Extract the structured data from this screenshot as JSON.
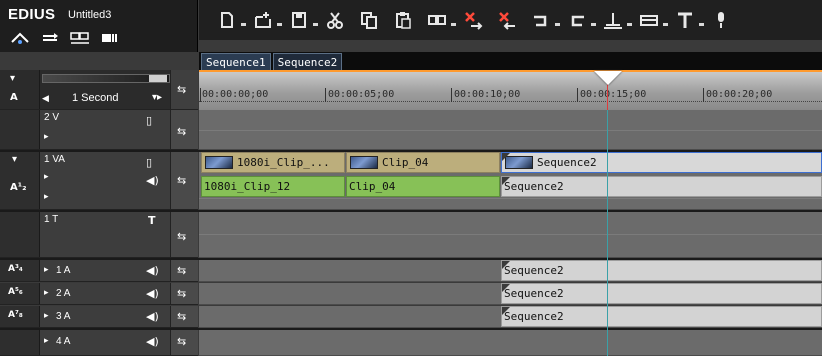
{
  "app": {
    "name": "EDIUS",
    "project": "Untitled3"
  },
  "tabs": [
    {
      "label": "Sequence1"
    },
    {
      "label": "Sequence2"
    }
  ],
  "ruler": {
    "timecodes": [
      "00:00:00;00",
      "00:00:05;00",
      "00:00:10;00",
      "00:00:15;00",
      "00:00:20;00"
    ],
    "scale_label": "1 Second"
  },
  "tracks": {
    "v2": {
      "name": "2 V"
    },
    "va1": {
      "name": "1 VA"
    },
    "t1": {
      "name": "1 T",
      "icon": "T"
    },
    "a1": {
      "name": "1 A"
    },
    "a2": {
      "name": "2 A"
    },
    "a3": {
      "name": "3 A"
    },
    "a4": {
      "name": "4 A"
    }
  },
  "clips": {
    "video": [
      {
        "label": "1080i_Clip_..."
      },
      {
        "label": "Clip_04"
      },
      {
        "label": "Sequence2"
      }
    ],
    "audio": [
      {
        "label": "1080i_Clip_12"
      },
      {
        "label": "Clip_04"
      },
      {
        "label": "Sequence2"
      }
    ],
    "audio_tracks_sequence_label": "Sequence2"
  },
  "colors": {
    "accent_orange": "#ff9a2e",
    "video_clip": "#bcae7c",
    "audio_clip": "#87c157",
    "selected_border": "#3d6fd1",
    "playhead": "#3aa1a8"
  },
  "icons": {
    "toolbar": [
      "new-sequence-icon",
      "add-track-icon",
      "save-icon",
      "cut-icon",
      "copy-icon",
      "paste-icon",
      "insert-mode-icon",
      "delete-icon",
      "ripple-delete-icon",
      "undo-icon",
      "redo-icon",
      "set-in-icon",
      "render-icon",
      "text-icon",
      "voice-over-icon"
    ]
  }
}
